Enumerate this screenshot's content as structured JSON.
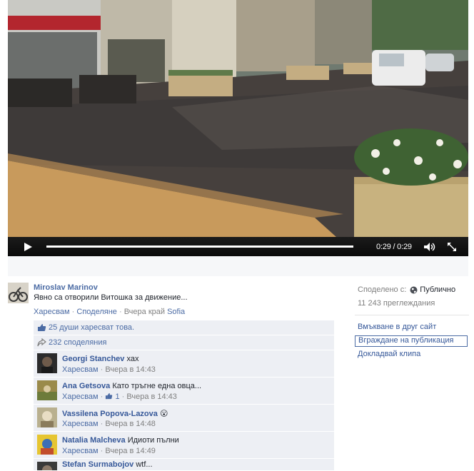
{
  "video": {
    "time_display": "0:29 / 0:29",
    "progress_fraction": 1.0
  },
  "post": {
    "author": "Miroslav Marinov",
    "text": "Явно са отворили Витошка за движение...",
    "actions": {
      "like": "Харесвам",
      "share": "Споделяне",
      "time": "Вчера край",
      "location": "Sofia"
    }
  },
  "ufi": {
    "likes": "25 души харесват това.",
    "shares": "232 споделяния",
    "comments": [
      {
        "name": "Georgi Stanchev",
        "text": "хах",
        "like": "Харесвам",
        "like_count": "",
        "time": "Вчера в 14:43"
      },
      {
        "name": "Ana Getsova",
        "text": "Като тръгне една овца...",
        "like": "Харесвам",
        "like_count": "1",
        "time": "Вчера в 14:43"
      },
      {
        "name": "Vassilena Popova-Lazova",
        "text": "😮",
        "like": "Харесвам",
        "like_count": "",
        "time": "Вчера в 14:48"
      },
      {
        "name": "Natalia Malcheva",
        "text": "Идиоти пълни",
        "like": "Харесвам",
        "like_count": "",
        "time": "Вчера в 14:49"
      },
      {
        "name": "Stefan Surmabojov",
        "text": "wtf...",
        "like": "",
        "like_count": "",
        "time": ""
      }
    ]
  },
  "sidebar": {
    "shared_with_label": "Споделено с:",
    "audience": "Публично",
    "views": "11 243 преглеждания",
    "links": [
      "Вмъкване в друг сайт",
      "Вграждане на публикация",
      "Докладвай клипа"
    ]
  },
  "colors": {
    "link": "#365899",
    "meta": "#7f7f7f",
    "ufi_bg": "#edeff4",
    "controls_bg": "#0a0a0a"
  }
}
